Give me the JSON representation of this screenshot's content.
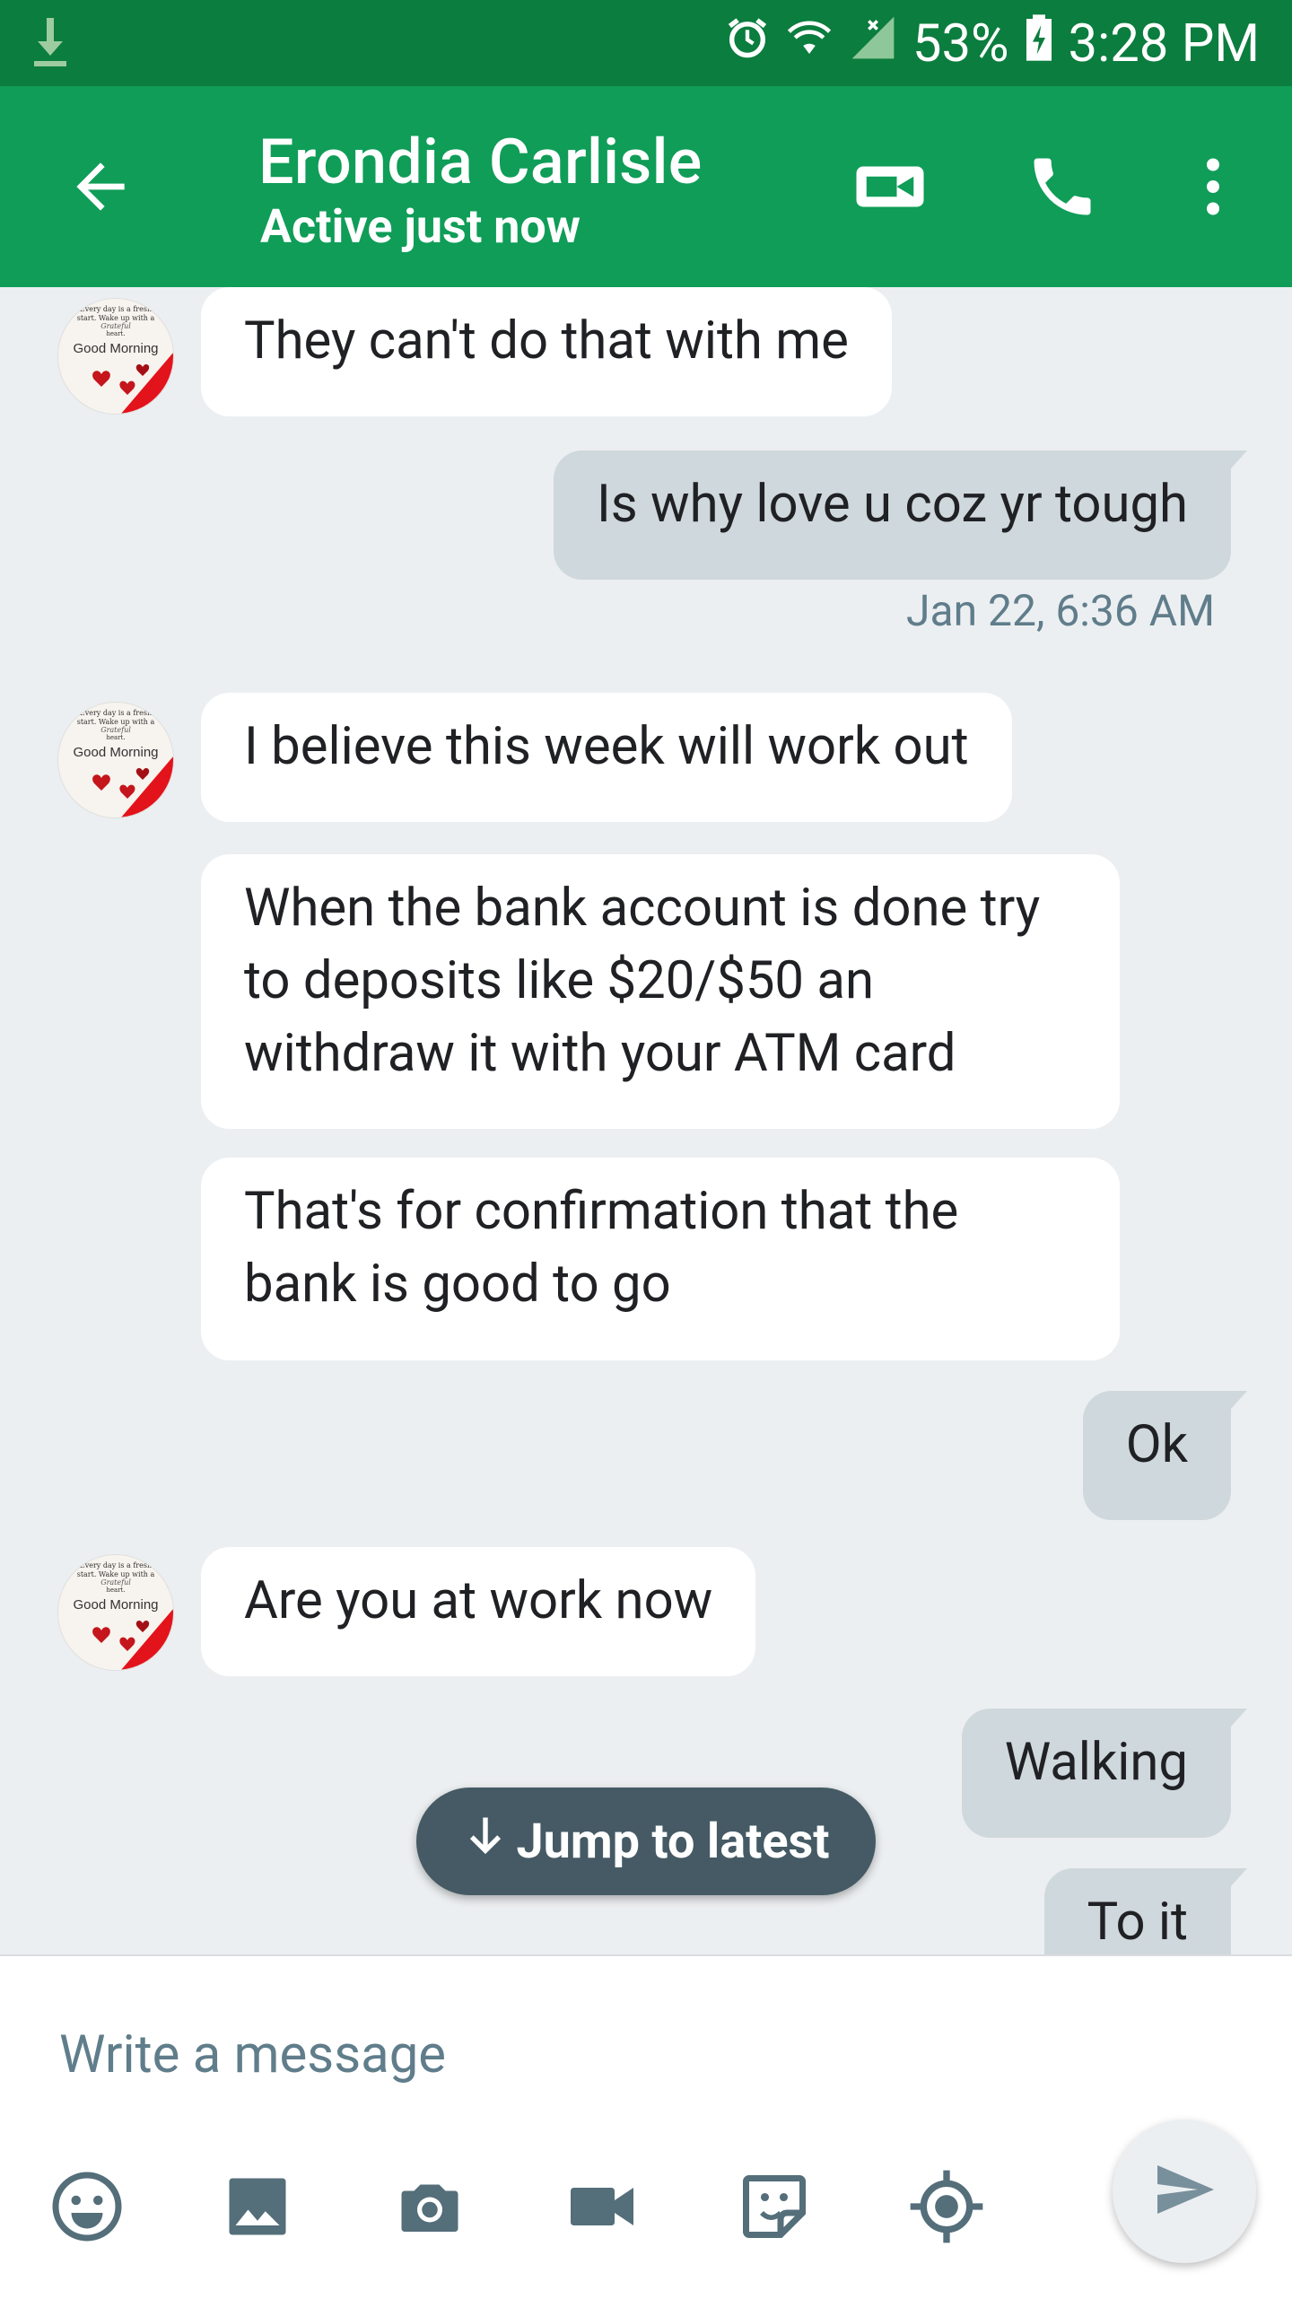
{
  "status_bar": {
    "battery_percent": "53%",
    "time": "3:28 PM",
    "icons": [
      "download-icon",
      "alarm-icon",
      "wifi-icon",
      "signal-icon",
      "battery-charging-icon"
    ]
  },
  "app_bar": {
    "contact_name": "Erondia Carlisle",
    "status": "Active just now",
    "icons": [
      "back-arrow-icon",
      "video-call-icon",
      "phone-icon",
      "more-vert-icon"
    ]
  },
  "messages": [
    {
      "dir": "in",
      "text": "They can't do that with me",
      "avatar": true
    },
    {
      "dir": "out",
      "text": "Is why love u coz yr tough"
    },
    {
      "timestamp": "Jan 22, 6:36 AM"
    },
    {
      "dir": "in",
      "text": "I believe this week will work out",
      "avatar": true
    },
    {
      "dir": "in",
      "text": "When the bank account is done try to deposits like $20/$50 an withdraw it with your ATM card"
    },
    {
      "dir": "in",
      "text": "That's for confirmation that the bank is good to go"
    },
    {
      "dir": "out",
      "text": "Ok"
    },
    {
      "dir": "in",
      "text": "Are you at work now",
      "avatar": true
    },
    {
      "dir": "out",
      "text": "Walking"
    },
    {
      "dir": "out",
      "text": "To it"
    }
  ],
  "avatar_text": {
    "line1": "Every day is a fresh",
    "line2": "start. Wake up with a",
    "line3": "Grateful",
    "line4": "heart.",
    "main": "Good Morning"
  },
  "jump_button": {
    "label": "Jump to latest"
  },
  "composer": {
    "placeholder": "Write a message",
    "toolbar_icons": [
      "emoji-icon",
      "image-icon",
      "camera-icon",
      "video-icon",
      "sticker-icon",
      "location-icon",
      "send-icon"
    ]
  },
  "colors": {
    "status_bar": "#0b7d3e",
    "app_bar": "#0f9d58",
    "background": "#eceff1",
    "incoming_bubble": "#ffffff",
    "outgoing_bubble": "#cfd8dc",
    "jump_button": "#455a64"
  }
}
